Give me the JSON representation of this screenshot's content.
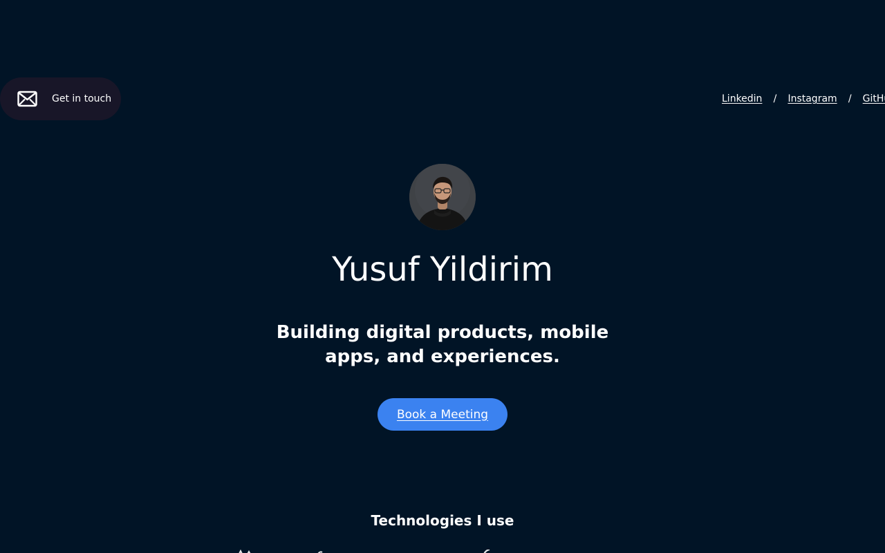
{
  "header": {
    "contact": {
      "label": "Get in touch",
      "icon": "mail-icon"
    },
    "social_links": [
      {
        "label": "Linkedin"
      },
      {
        "label": "Instagram"
      },
      {
        "label": "GitHub"
      }
    ],
    "separator": "/"
  },
  "hero": {
    "avatar_alt": "avatar",
    "name": "Yusuf Yildirim",
    "tagline": "Building digital products, mobile apps, and experiences.",
    "cta_label": "Book a Meeting"
  },
  "technologies": {
    "title": "Technologies I use"
  },
  "colors": {
    "background": "#011426",
    "pill_background": "#181628",
    "accent": "#3b82f0",
    "text": "#ffffff"
  }
}
